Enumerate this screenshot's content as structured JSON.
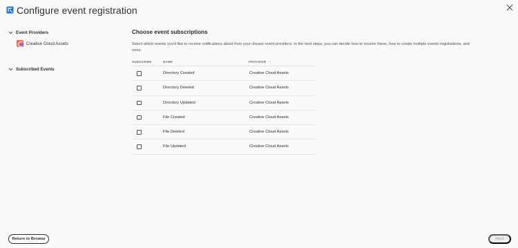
{
  "header": {
    "title": "Configure event registration",
    "app_icon": "event-registration-icon",
    "close_icon": "close-icon"
  },
  "sidebar": {
    "event_providers_label": "Event Providers",
    "provider_item_label": "Creative Cloud Assets",
    "subscribed_events_label": "Subscribed Events"
  },
  "main": {
    "title": "Choose event subscriptions",
    "description": "Select which events you'd like to receive notifications about from your chosen event providers. In the next steps, you can decide how to receive these, how to create multiple events registrations, and more."
  },
  "table": {
    "headers": {
      "subscribe": "SUBSCRIBE",
      "name": "NAME",
      "provider": "PROVIDER"
    },
    "rows": [
      {
        "name": "Directory Created",
        "provider": "Creative Cloud Assets",
        "checked": false
      },
      {
        "name": "Directory Deleted",
        "provider": "Creative Cloud Assets",
        "checked": false
      },
      {
        "name": "Directory Updated",
        "provider": "Creative Cloud Assets",
        "checked": false
      },
      {
        "name": "File Created",
        "provider": "Creative Cloud Assets",
        "checked": false
      },
      {
        "name": "File Deleted",
        "provider": "Creative Cloud Assets",
        "checked": false
      },
      {
        "name": "File Updated",
        "provider": "Creative Cloud Assets",
        "checked": false
      }
    ]
  },
  "footer": {
    "return_label": "Return to Browse",
    "next_label": "Next"
  },
  "colors": {
    "text": "#2c2c2c",
    "muted": "#6e6e6e",
    "background": "#fafafa",
    "app_icon_blue": "#1473e6"
  }
}
